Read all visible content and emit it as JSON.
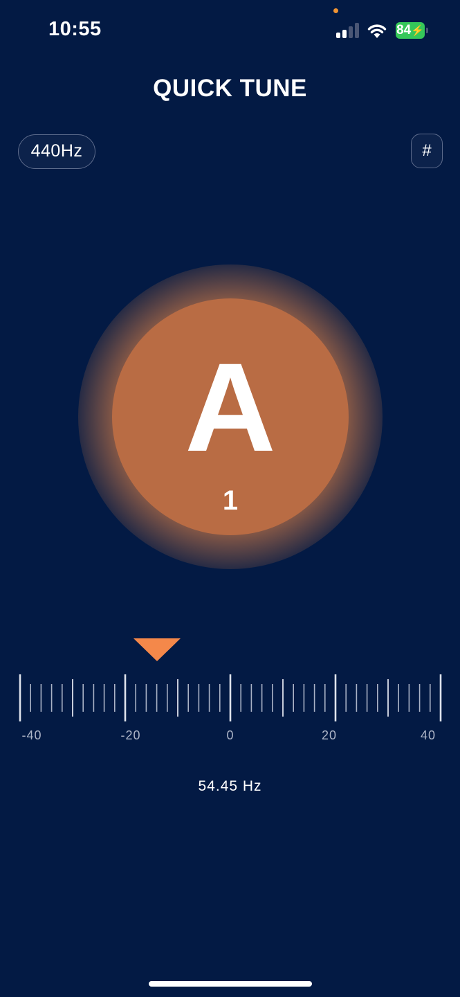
{
  "status_bar": {
    "time": "10:55",
    "battery": "84"
  },
  "header": {
    "title": "QUICK TUNE"
  },
  "controls": {
    "reference_pitch": "440Hz",
    "accidental": "#"
  },
  "note": {
    "name": "A",
    "octave": "1"
  },
  "gauge": {
    "cents": -14,
    "scale_labels": [
      "-40",
      "-20",
      "0",
      "20",
      "40"
    ],
    "frequency": "54.45 Hz"
  },
  "colors": {
    "background": "#031a44",
    "accent": "#f4884a",
    "note_circle": "#b96c44",
    "battery": "#35c759"
  },
  "icons": [
    "cellular-signal-icon",
    "wifi-icon",
    "battery-icon",
    "pointer-triangle-icon"
  ]
}
